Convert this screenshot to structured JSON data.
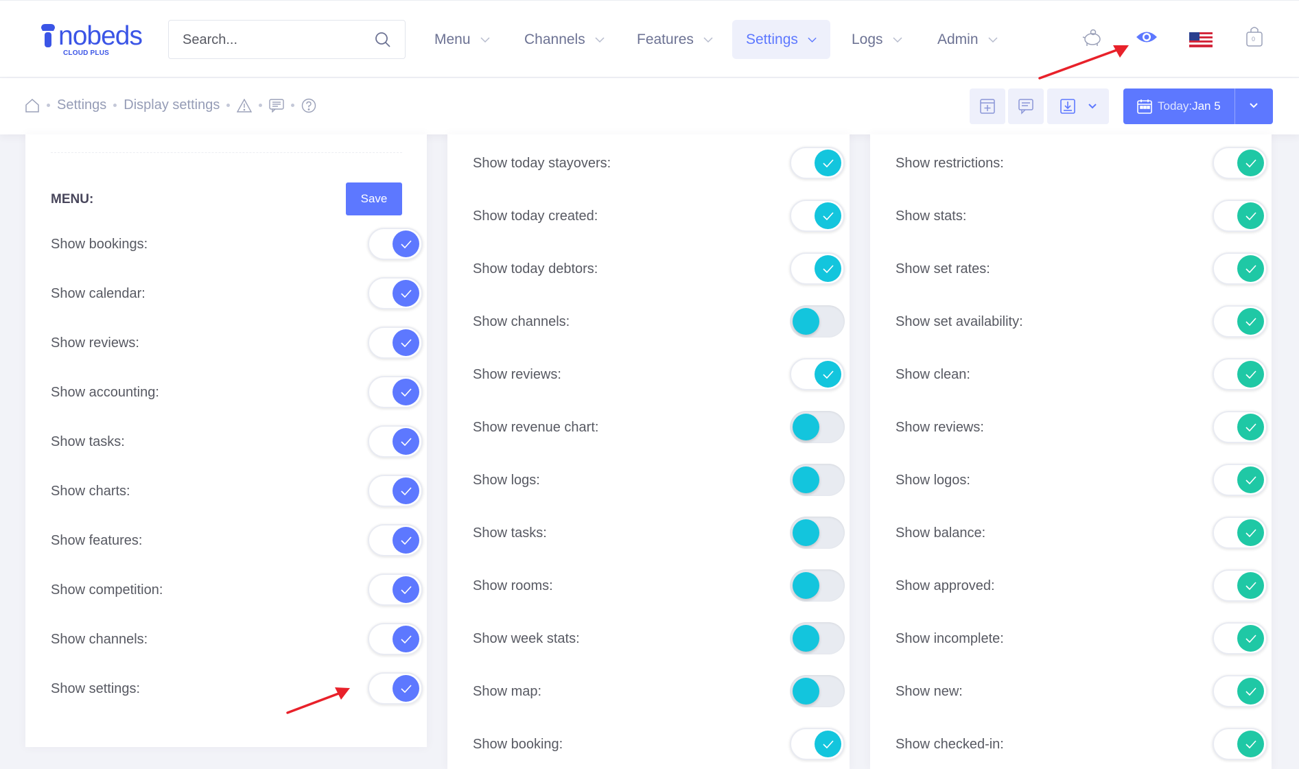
{
  "header": {
    "logo": {
      "text": "nobeds",
      "subtitle": "CLOUD PLUS"
    },
    "search": {
      "placeholder": "Search...",
      "value": ""
    },
    "nav": [
      {
        "label": "Menu",
        "active": false
      },
      {
        "label": "Channels",
        "active": false
      },
      {
        "label": "Features",
        "active": false
      },
      {
        "label": "Settings",
        "active": true
      },
      {
        "label": "Logs",
        "active": false
      },
      {
        "label": "Admin",
        "active": false
      }
    ],
    "icons": [
      "piggy-bank-icon",
      "eye-icon",
      "us-flag-icon",
      "cart-icon"
    ],
    "cart_count": "0"
  },
  "breadcrumb": {
    "items": [
      "Settings",
      "Display settings"
    ],
    "icons": [
      "home-icon",
      "warning-icon",
      "comment-icon",
      "help-icon"
    ]
  },
  "toolbar": {
    "date_prefix": "Today:",
    "date_value": "Jan 5"
  },
  "panel1": {
    "title": "MENU:",
    "save_label": "Save",
    "toggles": [
      {
        "label": "Show bookings:",
        "on": true
      },
      {
        "label": "Show calendar:",
        "on": true
      },
      {
        "label": "Show reviews:",
        "on": true
      },
      {
        "label": "Show accounting:",
        "on": true
      },
      {
        "label": "Show tasks:",
        "on": true
      },
      {
        "label": "Show charts:",
        "on": true
      },
      {
        "label": "Show features:",
        "on": true
      },
      {
        "label": "Show competition:",
        "on": true
      },
      {
        "label": "Show channels:",
        "on": true
      },
      {
        "label": "Show settings:",
        "on": true
      }
    ]
  },
  "panel2": {
    "toggles": [
      {
        "label": "Show today stayovers:",
        "on": true
      },
      {
        "label": "Show today created:",
        "on": true
      },
      {
        "label": "Show today debtors:",
        "on": true
      },
      {
        "label": "Show channels:",
        "on": false
      },
      {
        "label": "Show reviews:",
        "on": true
      },
      {
        "label": "Show revenue chart:",
        "on": false
      },
      {
        "label": "Show logs:",
        "on": false
      },
      {
        "label": "Show tasks:",
        "on": false
      },
      {
        "label": "Show rooms:",
        "on": false
      },
      {
        "label": "Show week stats:",
        "on": false
      },
      {
        "label": "Show map:",
        "on": false
      },
      {
        "label": "Show booking:",
        "on": true
      }
    ]
  },
  "panel3": {
    "toggles": [
      {
        "label": "Show restrictions:",
        "on": true
      },
      {
        "label": "Show stats:",
        "on": true
      },
      {
        "label": "Show set rates:",
        "on": true
      },
      {
        "label": "Show set availability:",
        "on": true
      },
      {
        "label": "Show clean:",
        "on": true
      },
      {
        "label": "Show reviews:",
        "on": true
      },
      {
        "label": "Show logos:",
        "on": true
      },
      {
        "label": "Show balance:",
        "on": true
      },
      {
        "label": "Show approved:",
        "on": true
      },
      {
        "label": "Show incomplete:",
        "on": true
      },
      {
        "label": "Show new:",
        "on": true
      },
      {
        "label": "Show checked-in:",
        "on": true
      }
    ]
  },
  "colors": {
    "brand": "#3b55e6",
    "accent": "#5d78ff",
    "toggle_menu": "#5d78ff",
    "toggle_dashboard": "#13c5dd",
    "toggle_calendar": "#1fc8a5",
    "annotation_arrow": "#e8212a"
  }
}
